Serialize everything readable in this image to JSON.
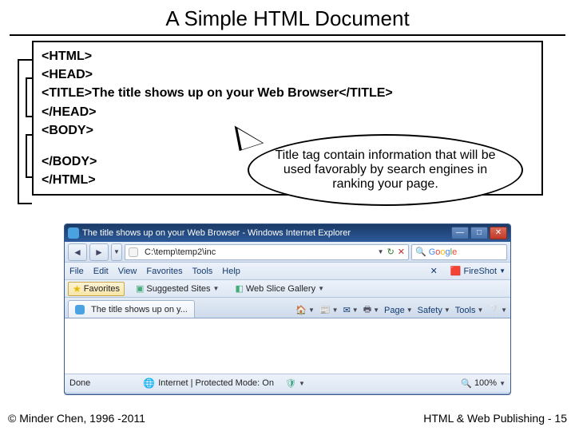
{
  "slide": {
    "title": "A Simple HTML Document",
    "code": {
      "l1": "<HTML>",
      "l2": "<HEAD>",
      "l3": "<TITLE>The title shows up on your Web Browser</TITLE>",
      "l4": "</HEAD>",
      "l5": "<BODY>",
      "l6": "</BODY>",
      "l7": "</HTML>"
    },
    "callout": "Title tag contain information that will be used favorably by search engines in ranking your page."
  },
  "browser": {
    "title": "The title shows up on your Web Browser - Windows Internet Explorer",
    "address": "C:\\temp\\temp2\\inc",
    "search_placeholder": "Google",
    "menu": {
      "file": "File",
      "edit": "Edit",
      "view": "View",
      "favorites": "Favorites",
      "tools": "Tools",
      "help": "Help",
      "fireshot": "FireShot"
    },
    "favbar": {
      "favorites": "Favorites",
      "suggested": "Suggested Sites",
      "webslice": "Web Slice Gallery"
    },
    "tab": "The title shows up on y...",
    "toolbar": {
      "page": "Page",
      "safety": "Safety",
      "tools": "Tools"
    },
    "status": {
      "done": "Done",
      "zone": "Internet | Protected Mode: On",
      "zoom": "100%"
    }
  },
  "footer": {
    "left": "© Minder Chen, 1996 -2011",
    "right": "HTML & Web Publishing - 15"
  }
}
